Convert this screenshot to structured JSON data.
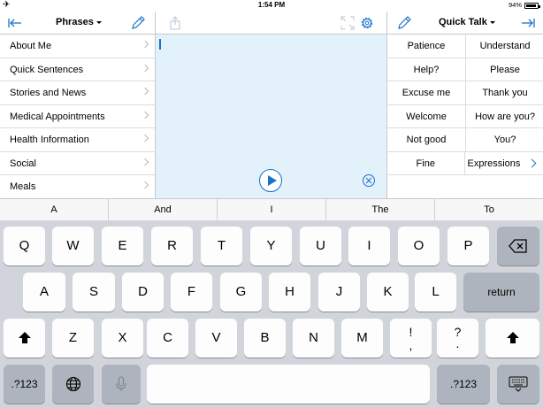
{
  "status_bar": {
    "time": "1:54 PM",
    "battery_percent": "94%",
    "battery_level": 0.94
  },
  "left_panel": {
    "title": "Phrases",
    "items": [
      {
        "label": "About Me"
      },
      {
        "label": "Quick Sentences"
      },
      {
        "label": "Stories and News"
      },
      {
        "label": "Medical Appointments"
      },
      {
        "label": "Health Information"
      },
      {
        "label": "Social"
      },
      {
        "label": "Meals"
      }
    ]
  },
  "right_panel": {
    "title": "Quick Talk",
    "rows": [
      [
        "Patience",
        "Understand"
      ],
      [
        "Help?",
        "Please"
      ],
      [
        "Excuse me",
        "Thank you"
      ],
      [
        "Welcome",
        "How are you?"
      ],
      [
        "Not good",
        "You?"
      ],
      [
        "Fine",
        "Expressions"
      ]
    ]
  },
  "predictions": [
    "A",
    "And",
    "I",
    "The",
    "To"
  ],
  "keyboard": {
    "row1": [
      "Q",
      "W",
      "E",
      "R",
      "T",
      "Y",
      "U",
      "I",
      "O",
      "P"
    ],
    "row2": [
      "A",
      "S",
      "D",
      "F",
      "G",
      "H",
      "J",
      "K",
      "L"
    ],
    "row3": [
      "Z",
      "X",
      "C",
      "V",
      "B",
      "N",
      "M"
    ],
    "return_label": "return",
    "numbers_label": ".?123",
    "punct1": {
      "top": "!",
      "bottom": ","
    },
    "punct2": {
      "top": "?",
      "bottom": "."
    }
  },
  "colors": {
    "accent": "#1a73c9",
    "text_area_bg": "#e3f1fb",
    "keyboard_bg": "#d1d5db"
  },
  "icons": {
    "back": "arrow-left-bar-icon",
    "edit": "pencil-icon",
    "share": "share-icon",
    "fullscreen": "expand-icon",
    "settings": "gear-icon",
    "speak": "play-icon",
    "clear": "clear-circle-icon",
    "forward": "arrow-right-bar-icon",
    "backspace": "backspace-icon",
    "shift": "shift-icon",
    "globe": "globe-icon",
    "microphone": "microphone-icon",
    "dismiss_keyboard": "keyboard-dismiss-icon"
  }
}
